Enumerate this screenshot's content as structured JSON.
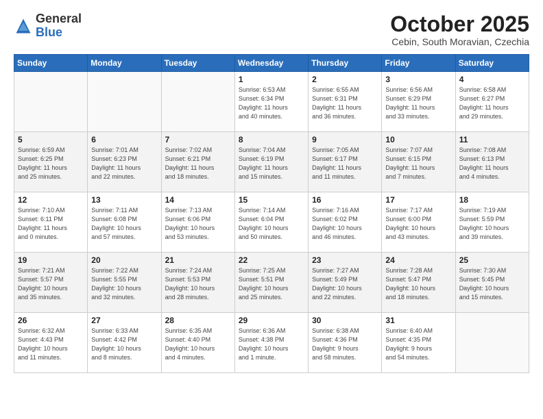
{
  "header": {
    "logo_general": "General",
    "logo_blue": "Blue",
    "month": "October 2025",
    "location": "Cebin, South Moravian, Czechia"
  },
  "weekdays": [
    "Sunday",
    "Monday",
    "Tuesday",
    "Wednesday",
    "Thursday",
    "Friday",
    "Saturday"
  ],
  "weeks": [
    {
      "shade": false,
      "days": [
        {
          "num": "",
          "info": ""
        },
        {
          "num": "",
          "info": ""
        },
        {
          "num": "",
          "info": ""
        },
        {
          "num": "1",
          "info": "Sunrise: 6:53 AM\nSunset: 6:34 PM\nDaylight: 11 hours\nand 40 minutes."
        },
        {
          "num": "2",
          "info": "Sunrise: 6:55 AM\nSunset: 6:31 PM\nDaylight: 11 hours\nand 36 minutes."
        },
        {
          "num": "3",
          "info": "Sunrise: 6:56 AM\nSunset: 6:29 PM\nDaylight: 11 hours\nand 33 minutes."
        },
        {
          "num": "4",
          "info": "Sunrise: 6:58 AM\nSunset: 6:27 PM\nDaylight: 11 hours\nand 29 minutes."
        }
      ]
    },
    {
      "shade": true,
      "days": [
        {
          "num": "5",
          "info": "Sunrise: 6:59 AM\nSunset: 6:25 PM\nDaylight: 11 hours\nand 25 minutes."
        },
        {
          "num": "6",
          "info": "Sunrise: 7:01 AM\nSunset: 6:23 PM\nDaylight: 11 hours\nand 22 minutes."
        },
        {
          "num": "7",
          "info": "Sunrise: 7:02 AM\nSunset: 6:21 PM\nDaylight: 11 hours\nand 18 minutes."
        },
        {
          "num": "8",
          "info": "Sunrise: 7:04 AM\nSunset: 6:19 PM\nDaylight: 11 hours\nand 15 minutes."
        },
        {
          "num": "9",
          "info": "Sunrise: 7:05 AM\nSunset: 6:17 PM\nDaylight: 11 hours\nand 11 minutes."
        },
        {
          "num": "10",
          "info": "Sunrise: 7:07 AM\nSunset: 6:15 PM\nDaylight: 11 hours\nand 7 minutes."
        },
        {
          "num": "11",
          "info": "Sunrise: 7:08 AM\nSunset: 6:13 PM\nDaylight: 11 hours\nand 4 minutes."
        }
      ]
    },
    {
      "shade": false,
      "days": [
        {
          "num": "12",
          "info": "Sunrise: 7:10 AM\nSunset: 6:11 PM\nDaylight: 11 hours\nand 0 minutes."
        },
        {
          "num": "13",
          "info": "Sunrise: 7:11 AM\nSunset: 6:08 PM\nDaylight: 10 hours\nand 57 minutes."
        },
        {
          "num": "14",
          "info": "Sunrise: 7:13 AM\nSunset: 6:06 PM\nDaylight: 10 hours\nand 53 minutes."
        },
        {
          "num": "15",
          "info": "Sunrise: 7:14 AM\nSunset: 6:04 PM\nDaylight: 10 hours\nand 50 minutes."
        },
        {
          "num": "16",
          "info": "Sunrise: 7:16 AM\nSunset: 6:02 PM\nDaylight: 10 hours\nand 46 minutes."
        },
        {
          "num": "17",
          "info": "Sunrise: 7:17 AM\nSunset: 6:00 PM\nDaylight: 10 hours\nand 43 minutes."
        },
        {
          "num": "18",
          "info": "Sunrise: 7:19 AM\nSunset: 5:59 PM\nDaylight: 10 hours\nand 39 minutes."
        }
      ]
    },
    {
      "shade": true,
      "days": [
        {
          "num": "19",
          "info": "Sunrise: 7:21 AM\nSunset: 5:57 PM\nDaylight: 10 hours\nand 35 minutes."
        },
        {
          "num": "20",
          "info": "Sunrise: 7:22 AM\nSunset: 5:55 PM\nDaylight: 10 hours\nand 32 minutes."
        },
        {
          "num": "21",
          "info": "Sunrise: 7:24 AM\nSunset: 5:53 PM\nDaylight: 10 hours\nand 28 minutes."
        },
        {
          "num": "22",
          "info": "Sunrise: 7:25 AM\nSunset: 5:51 PM\nDaylight: 10 hours\nand 25 minutes."
        },
        {
          "num": "23",
          "info": "Sunrise: 7:27 AM\nSunset: 5:49 PM\nDaylight: 10 hours\nand 22 minutes."
        },
        {
          "num": "24",
          "info": "Sunrise: 7:28 AM\nSunset: 5:47 PM\nDaylight: 10 hours\nand 18 minutes."
        },
        {
          "num": "25",
          "info": "Sunrise: 7:30 AM\nSunset: 5:45 PM\nDaylight: 10 hours\nand 15 minutes."
        }
      ]
    },
    {
      "shade": false,
      "days": [
        {
          "num": "26",
          "info": "Sunrise: 6:32 AM\nSunset: 4:43 PM\nDaylight: 10 hours\nand 11 minutes."
        },
        {
          "num": "27",
          "info": "Sunrise: 6:33 AM\nSunset: 4:42 PM\nDaylight: 10 hours\nand 8 minutes."
        },
        {
          "num": "28",
          "info": "Sunrise: 6:35 AM\nSunset: 4:40 PM\nDaylight: 10 hours\nand 4 minutes."
        },
        {
          "num": "29",
          "info": "Sunrise: 6:36 AM\nSunset: 4:38 PM\nDaylight: 10 hours\nand 1 minute."
        },
        {
          "num": "30",
          "info": "Sunrise: 6:38 AM\nSunset: 4:36 PM\nDaylight: 9 hours\nand 58 minutes."
        },
        {
          "num": "31",
          "info": "Sunrise: 6:40 AM\nSunset: 4:35 PM\nDaylight: 9 hours\nand 54 minutes."
        },
        {
          "num": "",
          "info": ""
        }
      ]
    }
  ]
}
